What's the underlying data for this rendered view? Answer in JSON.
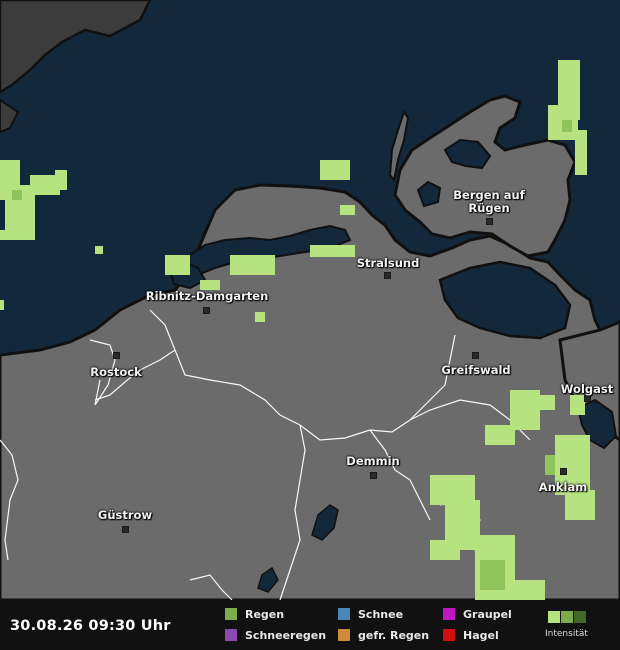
{
  "map": {
    "timestamp": "30.08.26 09:30 Uhr",
    "colors": {
      "sea": "#14283c",
      "land": "#6b6b6b",
      "land_north": "#3c3c3c",
      "coast": "#101010",
      "border": "#ffffff",
      "rain_light": "#b6e37f",
      "rain_medium": "#8fc45a",
      "rain_heavy": "#5f8a3a"
    },
    "cities": [
      {
        "id": "bergen",
        "lines": [
          "Bergen auf",
          "Rügen"
        ]
      },
      {
        "id": "stralsund",
        "lines": [
          "Stralsund"
        ]
      },
      {
        "id": "ribnitz",
        "lines": [
          "Ribnitz-Damgarten"
        ]
      },
      {
        "id": "rostock",
        "lines": [
          "Rostock"
        ]
      },
      {
        "id": "greifswald",
        "lines": [
          "Greifswald"
        ]
      },
      {
        "id": "wolgast",
        "lines": [
          "Wolgast"
        ]
      },
      {
        "id": "demmin",
        "lines": [
          "Demmin"
        ]
      },
      {
        "id": "anklam",
        "lines": [
          "Anklam"
        ]
      },
      {
        "id": "guestrow",
        "lines": [
          "Güstrow"
        ]
      }
    ]
  },
  "legend": {
    "items": [
      {
        "label": "Regen",
        "color": "#7cad4a"
      },
      {
        "label": "Schnee",
        "color": "#4a86b8"
      },
      {
        "label": "Graupel",
        "color": "#c018c0"
      },
      {
        "label": "Schneeregen",
        "color": "#8a48b0"
      },
      {
        "label": "gefr. Regen",
        "color": "#d08a3a"
      },
      {
        "label": "Hagel",
        "color": "#d01010"
      }
    ],
    "intensity_label": "Intensität",
    "intensity_colors": [
      "#b6e37f",
      "#7cad4a",
      "#3f6a2a"
    ]
  }
}
